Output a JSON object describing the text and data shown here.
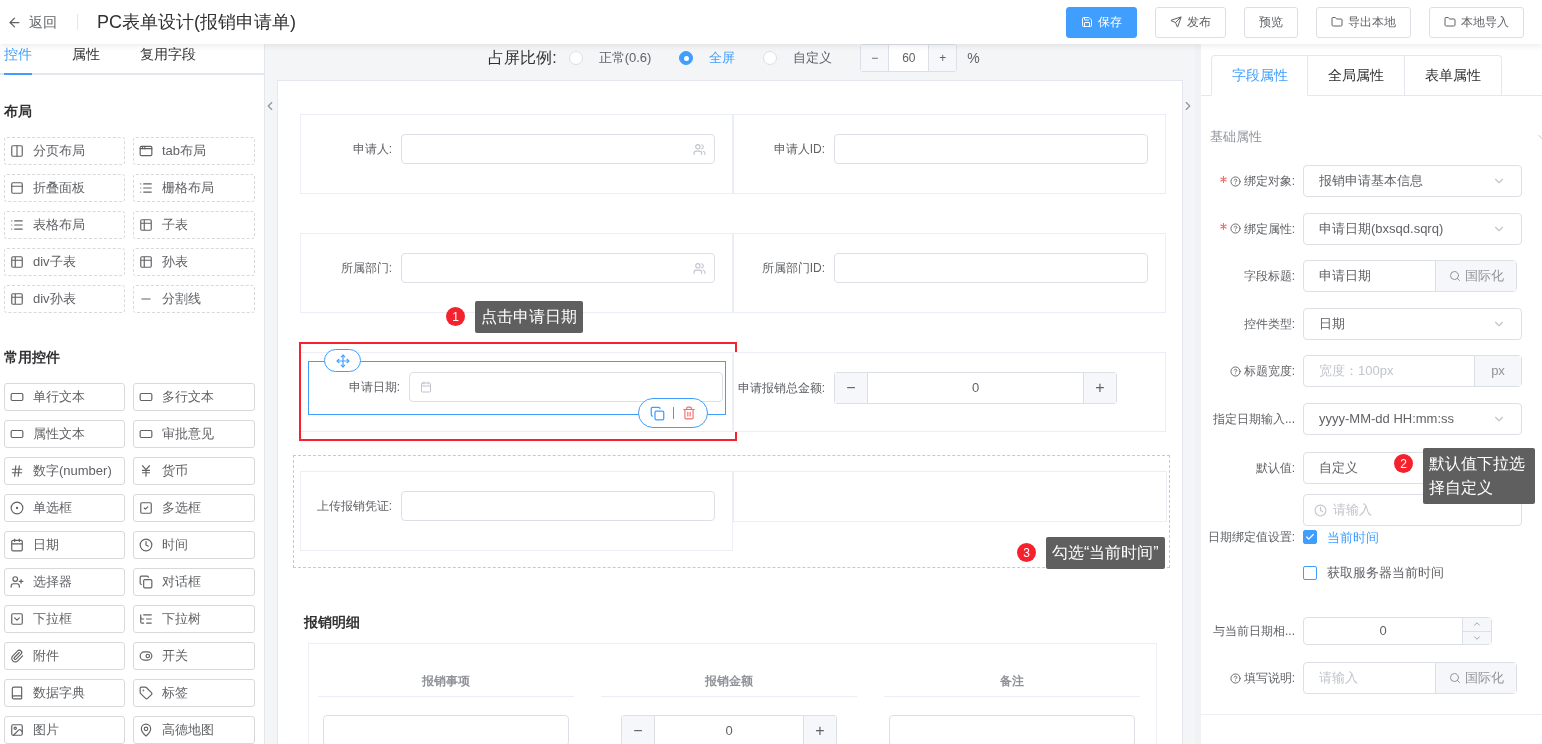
{
  "header": {
    "back": "返回",
    "title": "PC表单设计(报销申请单)",
    "buttons": [
      {
        "label": "保存",
        "kind": "primary"
      },
      {
        "label": "发布",
        "kind": "default"
      },
      {
        "label": "预览",
        "kind": "default"
      },
      {
        "label": "导出本地",
        "kind": "default"
      },
      {
        "label": "本地导入",
        "kind": "default"
      }
    ]
  },
  "left_panel": {
    "tabs": [
      {
        "label": "控件",
        "selected": true
      },
      {
        "label": "属性",
        "selected": false
      },
      {
        "label": "复用字段",
        "selected": false
      }
    ],
    "sections": [
      {
        "title": "布局",
        "dashed": true,
        "items": [
          {
            "label": "分页布局"
          },
          {
            "label": "tab布局"
          },
          {
            "label": "折叠面板"
          },
          {
            "label": "栅格布局"
          },
          {
            "label": "表格布局"
          },
          {
            "label": "子表"
          },
          {
            "label": "div子表"
          },
          {
            "label": "孙表"
          },
          {
            "label": "div孙表"
          },
          {
            "label": "分割线"
          }
        ]
      },
      {
        "title": "常用控件",
        "dashed": false,
        "items": [
          {
            "label": "单行文本"
          },
          {
            "label": "多行文本"
          },
          {
            "label": "属性文本"
          },
          {
            "label": "审批意见"
          },
          {
            "label": "数字(number)"
          },
          {
            "label": "货币"
          },
          {
            "label": "单选框"
          },
          {
            "label": "多选框"
          },
          {
            "label": "日期"
          },
          {
            "label": "时间"
          },
          {
            "label": "选择器"
          },
          {
            "label": "对话框"
          },
          {
            "label": "下拉框"
          },
          {
            "label": "下拉树"
          },
          {
            "label": "附件"
          },
          {
            "label": "开关"
          },
          {
            "label": "数据字典"
          },
          {
            "label": "标签"
          },
          {
            "label": "图片"
          },
          {
            "label": "高德地图"
          }
        ]
      }
    ]
  },
  "canvas": {
    "ratio": {
      "label": "占屏比例:",
      "options": [
        {
          "label": "正常(0.6)",
          "selected": false
        },
        {
          "label": "全屏",
          "selected": true
        },
        {
          "label": "自定义",
          "selected": false
        }
      ],
      "stepper": {
        "minus": "−",
        "value": "60",
        "plus": "+"
      },
      "unit": "%"
    },
    "rows": [
      {
        "outlined": false,
        "fields": [
          {
            "label": "申请人:",
            "kind": "picker",
            "selected": false
          },
          {
            "label": "申请人ID:",
            "kind": "text",
            "selected": false
          }
        ]
      },
      {
        "outlined": false,
        "fields": [
          {
            "label": "所属部门:",
            "kind": "picker",
            "selected": false
          },
          {
            "label": "所属部门ID:",
            "kind": "text",
            "selected": false
          }
        ]
      },
      {
        "outlined": false,
        "fields": [
          {
            "label": "申请日期:",
            "kind": "date",
            "selected": true
          },
          {
            "label": "申请报销总金额:",
            "kind": "number",
            "value": "0",
            "minus": "−",
            "plus": "+",
            "selected": false
          }
        ]
      },
      {
        "outlined": true,
        "fields": [
          {
            "label": "上传报销凭证:",
            "kind": "text",
            "selected": false
          },
          {
            "kind": "empty",
            "selected": false
          }
        ]
      }
    ],
    "subtable": {
      "title": "报销明细",
      "columns": [
        {
          "label": "报销事项",
          "kind": "text"
        },
        {
          "label": "报销金额",
          "kind": "number",
          "value": "0",
          "minus": "−",
          "plus": "+"
        },
        {
          "label": "备注",
          "kind": "text"
        }
      ]
    }
  },
  "right_panel": {
    "tabs": [
      {
        "label": "字段属性",
        "selected": true
      },
      {
        "label": "全局属性",
        "selected": false
      },
      {
        "label": "表单属性",
        "selected": false
      }
    ],
    "section": "基础属性",
    "fields": [
      {
        "label": "绑定对象:",
        "required": true,
        "help": true,
        "kind": "select",
        "value": "报销申请基本信息"
      },
      {
        "label": "绑定属性:",
        "required": true,
        "help": true,
        "kind": "select",
        "value": "申请日期(bxsqd.sqrq)"
      },
      {
        "label": "字段标题:",
        "required": false,
        "help": false,
        "kind": "addon",
        "value": "申请日期",
        "addon": "国际化"
      },
      {
        "label": "控件类型:",
        "required": false,
        "help": false,
        "kind": "select",
        "value": "日期"
      },
      {
        "label": "标题宽度:",
        "required": false,
        "help": true,
        "kind": "unit",
        "placeholder": "宽度：100px",
        "unit": "px"
      },
      {
        "label": "指定日期输入...",
        "required": false,
        "help": false,
        "kind": "select",
        "value": "yyyy-MM-dd HH:mm:ss"
      },
      {
        "label": "默认值:",
        "required": false,
        "help": false,
        "kind": "select",
        "value": "自定义"
      },
      {
        "kind": "time",
        "placeholder": "请输入"
      },
      {
        "label": "日期绑定值设置:",
        "required": false,
        "help": false,
        "kind": "checkboxes",
        "options": [
          {
            "label": "当前时间",
            "checked": true
          },
          {
            "label": "获取服务器当前时间",
            "checked": false
          }
        ]
      },
      {
        "label": "与当前日期相...",
        "required": false,
        "help": false,
        "kind": "spinner",
        "value": "0"
      },
      {
        "label": "填写说明:",
        "required": false,
        "help": true,
        "kind": "addon",
        "placeholder": "请输入",
        "addon": "国际化"
      }
    ]
  },
  "callouts": [
    {
      "number": "1",
      "text": "点击申请日期"
    },
    {
      "number": "2",
      "text": "默认值下拉选择自定义"
    },
    {
      "number": "3",
      "text": "勾选“当前时间”"
    }
  ]
}
